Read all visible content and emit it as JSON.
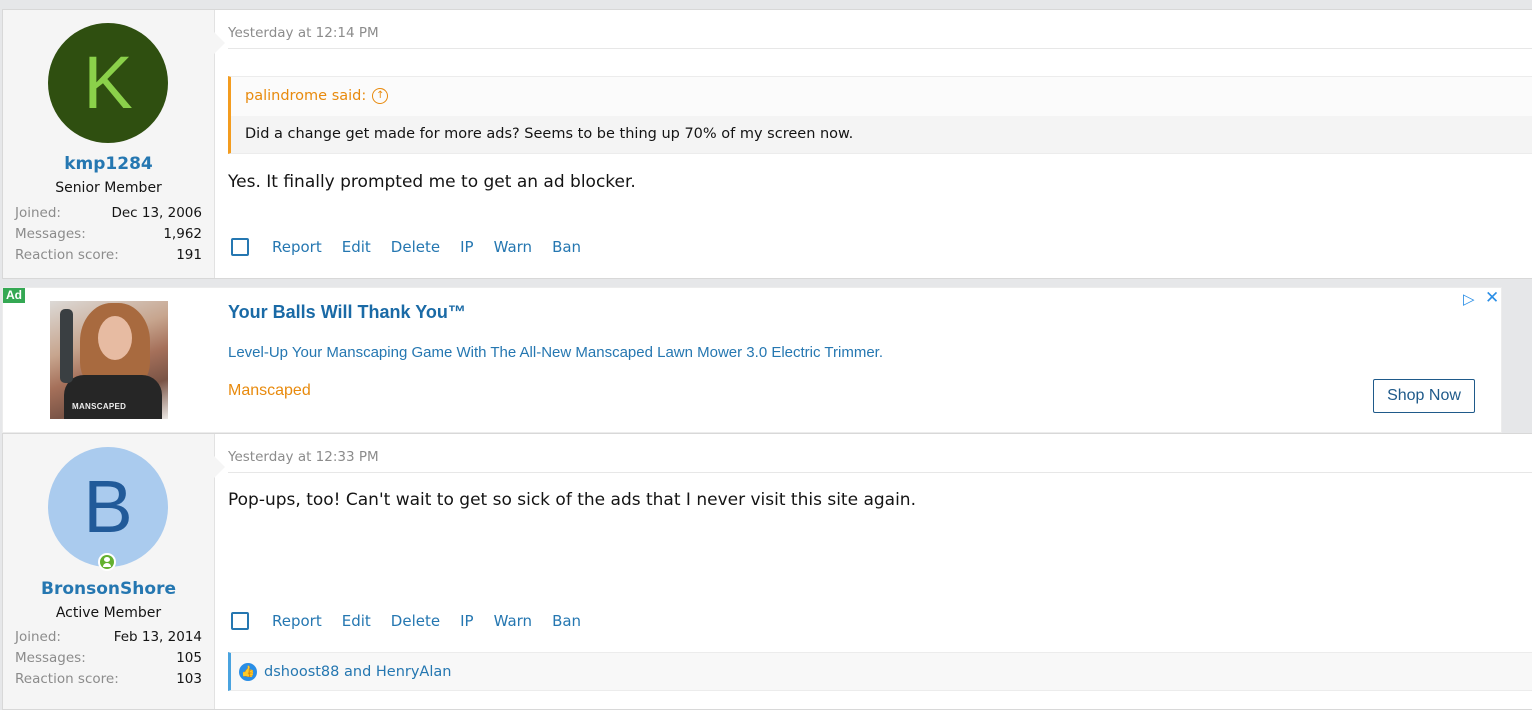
{
  "posts": [
    {
      "username": "kmp1284",
      "avatar_letter": "K",
      "user_title": "Senior Member",
      "stats": [
        {
          "label": "Joined:",
          "value": "Dec 13, 2006"
        },
        {
          "label": "Messages:",
          "value": "1,962"
        },
        {
          "label": "Reaction score:",
          "value": "191"
        }
      ],
      "date": "Yesterday at 12:14 PM",
      "quote": {
        "author": "palindrome said:",
        "text": "Did a change get made for more ads? Seems to be thing up 70% of my screen now."
      },
      "message": "Yes. It finally prompted me to get an ad blocker.",
      "actions": [
        "Report",
        "Edit",
        "Delete",
        "IP",
        "Warn",
        "Ban"
      ]
    },
    {
      "username": "BronsonShore",
      "avatar_letter": "B",
      "user_title": "Active Member",
      "stats": [
        {
          "label": "Joined:",
          "value": "Feb 13, 2014"
        },
        {
          "label": "Messages:",
          "value": "105"
        },
        {
          "label": "Reaction score:",
          "value": "103"
        }
      ],
      "date": "Yesterday at 12:33 PM",
      "message": "Pop-ups, too! Can't wait to get so sick of the ads that I never visit this site again.",
      "actions": [
        "Report",
        "Edit",
        "Delete",
        "IP",
        "Warn",
        "Ban"
      ],
      "reactions": "dshoost88 and HenryAlan"
    }
  ],
  "ad": {
    "tag": "Ad",
    "image_text": "MANSCAPED",
    "title": "Your Balls Will Thank You™",
    "description": "Level-Up Your Manscaping Game With The All-New Manscaped Lawn Mower 3.0 Electric Trimmer.",
    "brand": "Manscaped",
    "cta": "Shop Now",
    "choices_icon": "adchoices-icon",
    "close_icon": "close-icon"
  },
  "colors": {
    "link": "#2577b1",
    "quote_accent": "#f39c1f",
    "avatar_k_bg": "#2f4f10",
    "avatar_b_bg": "#aacbee"
  }
}
